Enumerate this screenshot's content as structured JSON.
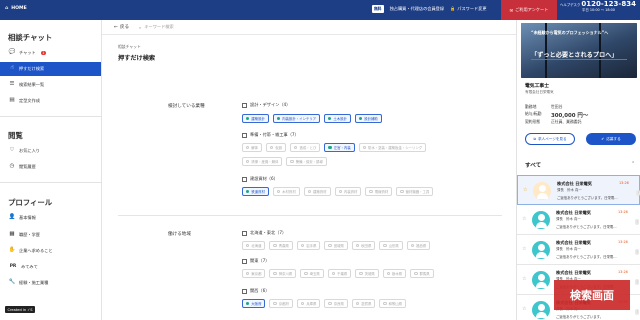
{
  "header": {
    "home_label": "HOME",
    "badge": "無料",
    "link1": "独占購買・代理店の会員登録",
    "link2": "パスワード変更",
    "cta": "ご利用アンケート",
    "help_label": "ヘルプデスク",
    "phone": "0120-123-834",
    "hours": "平日 10:00 〜 18:00"
  },
  "sidebar": {
    "sec1": "相談チャット",
    "chat": "チャット",
    "chat_badge": "1",
    "oshidake": "押すだけ検索",
    "history": "検索結果一覧",
    "templates": "定型文作成",
    "sec2": "閲覧",
    "favorites": "お気に入り",
    "viewed": "閲覧履歴",
    "sec3": "プロフィール",
    "basic": "基本情報",
    "career": "職歴・学歴",
    "company_req": "企業へ求めること",
    "pr": "PR",
    "pr_label": "みてみて",
    "work": "経験・施工業種",
    "created": "Created in ✓S"
  },
  "toolbar": {
    "back": "戻る",
    "search_placeholder": "キーワード検索"
  },
  "page": {
    "breadcrumb": "相談チャット",
    "title": "押すだけ検索"
  },
  "industry": {
    "label": "検討している業種",
    "g1": "設計・デザイン（4）",
    "g1_chips": [
      {
        "t": "建築設計",
        "on": true
      },
      {
        "t": "内装設計・インテリア",
        "on": true
      },
      {
        "t": "土木設計",
        "on": true
      },
      {
        "t": "設計補助",
        "on": true
      }
    ],
    "g2": "準備・付帯・雑工事（7）",
    "g2_chips_a": [
      {
        "t": "解体",
        "on": false
      },
      {
        "t": "仮設",
        "on": false
      },
      {
        "t": "造成・とび",
        "on": false
      },
      {
        "t": "左官・内装",
        "on": true
      },
      {
        "t": "防水・塗装・建築板金・シーリング",
        "on": false
      }
    ],
    "g2_chips_b": [
      {
        "t": "清掃・産廃・解体",
        "on": false
      },
      {
        "t": "警備・保安・誘導",
        "on": false
      }
    ],
    "g3": "建設資材（6）",
    "g3_chips": [
      {
        "t": "鉄道資材",
        "on": true
      },
      {
        "t": "木材資材",
        "on": false
      },
      {
        "t": "建築資材",
        "on": false
      },
      {
        "t": "内装資材",
        "on": false
      },
      {
        "t": "電線資材",
        "on": false
      },
      {
        "t": "管材機器・工具",
        "on": false
      }
    ]
  },
  "region": {
    "label": "働ける地域",
    "g1": "北海道・東北（7）",
    "g1_chips": [
      {
        "t": "北海道",
        "on": false
      },
      {
        "t": "青森県",
        "on": false
      },
      {
        "t": "岩手県",
        "on": false
      },
      {
        "t": "宮城県",
        "on": false
      },
      {
        "t": "秋田県",
        "on": false
      },
      {
        "t": "山形県",
        "on": false
      },
      {
        "t": "福島県",
        "on": false
      }
    ],
    "g2": "関東（7）",
    "g2_chips": [
      {
        "t": "東京都",
        "on": false
      },
      {
        "t": "神奈川県",
        "on": false
      },
      {
        "t": "埼玉県",
        "on": false
      },
      {
        "t": "千葉県",
        "on": false
      },
      {
        "t": "茨城県",
        "on": false
      },
      {
        "t": "栃木県",
        "on": false
      },
      {
        "t": "群馬県",
        "on": false
      }
    ],
    "g3": "関西（6）",
    "g3_chips": [
      {
        "t": "大阪府",
        "on": true
      },
      {
        "t": "京都府",
        "on": false
      },
      {
        "t": "兵庫県",
        "on": false
      },
      {
        "t": "奈良県",
        "on": false
      },
      {
        "t": "滋賀県",
        "on": false
      },
      {
        "t": "和歌山県",
        "on": false
      }
    ]
  },
  "right": {
    "ad_text1": "“未経験から電気のプロフェッショナル”へ",
    "ad_text2": "「ずっと必要とされるプロへ」",
    "company": "電気工事士",
    "company_sub": "有限会社日栄電気",
    "loc_k": "勤務地",
    "loc_v": "世田谷",
    "salary_k": "給与/転勤",
    "salary_v": "300,000 円〜",
    "contract_k": "契約形態",
    "contract_v": "正社員、業務委託",
    "btn_page": "求人ページを見る",
    "btn_apply": "応募する",
    "all": "すべて",
    "chats": [
      {
        "name": "株式会社 日栄電気",
        "person": "課長　鈴木 真一",
        "msg": "ご返信ありがとうございます。日栄電...",
        "time": "13:26",
        "sel": true
      },
      {
        "name": "株式会社 日栄電気",
        "person": "課長　鈴木 真一",
        "msg": "ご返信ありがとうございます。日栄電...",
        "time": "13:26",
        "sel": false
      },
      {
        "name": "株式会社 日栄電気",
        "person": "課長　鈴木 真一",
        "msg": "ご返信ありがとうございます。日栄電...",
        "time": "13:26",
        "sel": false
      },
      {
        "name": "株式会社 日栄電気",
        "person": "課長　鈴木 真一",
        "msg": "ご返信ありがとうございます。日栄電...",
        "time": "13:26",
        "sel": false
      },
      {
        "name": "株式会社 日栄電気",
        "person": "課長　鈴木 真一",
        "msg": "ご返信ありがとうございます。",
        "time": "13:26",
        "sel": false
      }
    ]
  },
  "overlay": "検索画面"
}
